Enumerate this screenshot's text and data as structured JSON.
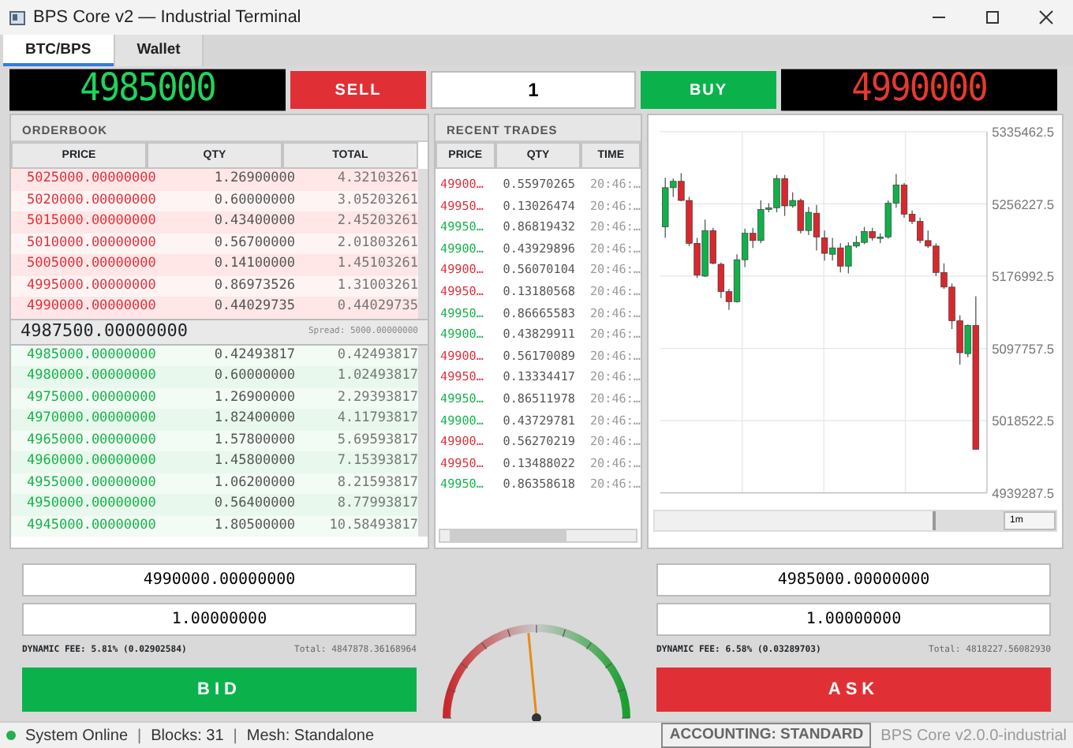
{
  "window": {
    "title": "BPS Core v2 — Industrial Terminal"
  },
  "tabs": [
    {
      "label": "BTC/BPS",
      "selected": true
    },
    {
      "label": "Wallet",
      "selected": false
    }
  ],
  "ticker": {
    "bid_display": "4985000",
    "sell_label": "SELL",
    "quantity": "1",
    "buy_label": "BUY",
    "ask_display": "4990000"
  },
  "orderbook": {
    "title": "ORDERBOOK",
    "columns": [
      "PRICE",
      "QTY",
      "TOTAL"
    ],
    "asks": [
      [
        "5025000.00000000",
        "1.26900000",
        "4.32103261"
      ],
      [
        "5020000.00000000",
        "0.60000000",
        "3.05203261"
      ],
      [
        "5015000.00000000",
        "0.43400000",
        "2.45203261"
      ],
      [
        "5010000.00000000",
        "0.56700000",
        "2.01803261"
      ],
      [
        "5005000.00000000",
        "0.14100000",
        "1.45103261"
      ],
      [
        "4995000.00000000",
        "0.86973526",
        "1.31003261"
      ],
      [
        "4990000.00000000",
        "0.44029735",
        "0.44029735"
      ]
    ],
    "mid_price": "4987500.00000000",
    "spread": "Spread: 5000.00000000",
    "bids": [
      [
        "4985000.00000000",
        "0.42493817",
        "0.42493817"
      ],
      [
        "4980000.00000000",
        "0.60000000",
        "1.02493817"
      ],
      [
        "4975000.00000000",
        "1.26900000",
        "2.29393817"
      ],
      [
        "4970000.00000000",
        "1.82400000",
        "4.11793817"
      ],
      [
        "4965000.00000000",
        "1.57800000",
        "5.69593817"
      ],
      [
        "4960000.00000000",
        "1.45800000",
        "7.15393817"
      ],
      [
        "4955000.00000000",
        "1.06200000",
        "8.21593817"
      ],
      [
        "4950000.00000000",
        "0.56400000",
        "8.77993817"
      ],
      [
        "4945000.00000000",
        "1.80500000",
        "10.58493817"
      ]
    ]
  },
  "recent_trades": {
    "title": "RECENT TRADES",
    "columns": [
      "PRICE",
      "QTY",
      "TIME"
    ],
    "rows": [
      {
        "color": "#e0303a",
        "price": "49900…",
        "qty": "0.55970265",
        "time": "20:46:…"
      },
      {
        "color": "#e0303a",
        "price": "49950…",
        "qty": "0.13026474",
        "time": "20:46:…"
      },
      {
        "color": "#16b34a",
        "price": "49950…",
        "qty": "0.86819432",
        "time": "20:46:…"
      },
      {
        "color": "#16b34a",
        "price": "49900…",
        "qty": "0.43929896",
        "time": "20:46:…"
      },
      {
        "color": "#e0303a",
        "price": "49900…",
        "qty": "0.56070104",
        "time": "20:46:…"
      },
      {
        "color": "#e0303a",
        "price": "49950…",
        "qty": "0.13180568",
        "time": "20:46:…"
      },
      {
        "color": "#16b34a",
        "price": "49950…",
        "qty": "0.86665583",
        "time": "20:46:…"
      },
      {
        "color": "#16b34a",
        "price": "49900…",
        "qty": "0.43829911",
        "time": "20:46:…"
      },
      {
        "color": "#e0303a",
        "price": "49900…",
        "qty": "0.56170089",
        "time": "20:46:…"
      },
      {
        "color": "#e0303a",
        "price": "49950…",
        "qty": "0.13334417",
        "time": "20:46:…"
      },
      {
        "color": "#16b34a",
        "price": "49950…",
        "qty": "0.86511978",
        "time": "20:46:…"
      },
      {
        "color": "#16b34a",
        "price": "49900…",
        "qty": "0.43729781",
        "time": "20:46:…"
      },
      {
        "color": "#e0303a",
        "price": "49900…",
        "qty": "0.56270219",
        "time": "20:46:…"
      },
      {
        "color": "#e0303a",
        "price": "49950…",
        "qty": "0.13488022",
        "time": "20:46:…"
      },
      {
        "color": "#16b34a",
        "price": "49950…",
        "qty": "0.86358618",
        "time": "20:46:…"
      }
    ]
  },
  "price_chart": {
    "chart_data": {
      "type": "candlestick",
      "grid": true,
      "ohlc": [
        [
          5231000,
          5285000,
          5219000,
          5274000
        ],
        [
          5274000,
          5284000,
          5264000,
          5281000
        ],
        [
          5281000,
          5290000,
          5259000,
          5260000
        ],
        [
          5260000,
          5264000,
          5210000,
          5213000
        ],
        [
          5213000,
          5219000,
          5175000,
          5178000
        ],
        [
          5177000,
          5239000,
          5176000,
          5227000
        ],
        [
          5227000,
          5230000,
          5190000,
          5191000
        ],
        [
          5190000,
          5192000,
          5153000,
          5160000
        ],
        [
          5160000,
          5163000,
          5140000,
          5149000
        ],
        [
          5149000,
          5201000,
          5148000,
          5195000
        ],
        [
          5195000,
          5229000,
          5187000,
          5224000
        ],
        [
          5224000,
          5230000,
          5208000,
          5216000
        ],
        [
          5216000,
          5260000,
          5213000,
          5250000
        ],
        [
          5250000,
          5257000,
          5247000,
          5252000
        ],
        [
          5252000,
          5288000,
          5247000,
          5284000
        ],
        [
          5284000,
          5288000,
          5243000,
          5254000
        ],
        [
          5254000,
          5269000,
          5252000,
          5260000
        ],
        [
          5260000,
          5262000,
          5224000,
          5227000
        ],
        [
          5227000,
          5253000,
          5222000,
          5247000
        ],
        [
          5246000,
          5255000,
          5205000,
          5220000
        ],
        [
          5219000,
          5227000,
          5194000,
          5202000
        ],
        [
          5201000,
          5219000,
          5194000,
          5208000
        ],
        [
          5208000,
          5213000,
          5181000,
          5188000
        ],
        [
          5188000,
          5214000,
          5180000,
          5210000
        ],
        [
          5210000,
          5221000,
          5208000,
          5214000
        ],
        [
          5214000,
          5231000,
          5212000,
          5226000
        ],
        [
          5226000,
          5230000,
          5216000,
          5219000
        ],
        [
          5219000,
          5224000,
          5213000,
          5220000
        ],
        [
          5220000,
          5260000,
          5218000,
          5257000
        ],
        [
          5257000,
          5289000,
          5252000,
          5277000
        ],
        [
          5277000,
          5279000,
          5241000,
          5245000
        ],
        [
          5245000,
          5249000,
          5234000,
          5237000
        ],
        [
          5237000,
          5241000,
          5213000,
          5216000
        ],
        [
          5216000,
          5227000,
          5208000,
          5210000
        ],
        [
          5210000,
          5213000,
          5177000,
          5181000
        ],
        [
          5181000,
          5191000,
          5163000,
          5165000
        ],
        [
          5165000,
          5169000,
          5119000,
          5128000
        ],
        [
          5128000,
          5134000,
          5080000,
          5093000
        ],
        [
          5092000,
          5124000,
          5088000,
          5123000
        ],
        [
          5123000,
          5155000,
          4987000,
          4987000
        ]
      ],
      "ylim": [
        4939287.5,
        5335462.5
      ],
      "yticks": [
        5335462.5,
        5256227.5,
        5176992.5,
        5097757.5,
        5018522.5,
        4939287.5
      ]
    },
    "interval": "1m"
  },
  "bid_panel": {
    "price": "4990000.00000000",
    "amount": "1.00000000",
    "fee": "DYNAMIC FEE: 5.81% (0.02902584)",
    "total": "Total: 4847878.36168964",
    "button": "BID"
  },
  "gauge": {
    "level": 0.47
  },
  "ask_panel": {
    "price": "4985000.00000000",
    "amount": "1.00000000",
    "fee": "DYNAMIC FEE: 6.58% (0.03289703)",
    "total": "Total: 4818227.56082930",
    "button": "ASK"
  },
  "status_bar": {
    "online": true,
    "status": "System Online",
    "separators": [
      "|",
      "|"
    ],
    "blocks": "Blocks: 31",
    "mesh": "Mesh: Standalone",
    "accounting": "ACCOUNTING: STANDARD",
    "version": "BPS Core v2.0.0-industrial"
  }
}
